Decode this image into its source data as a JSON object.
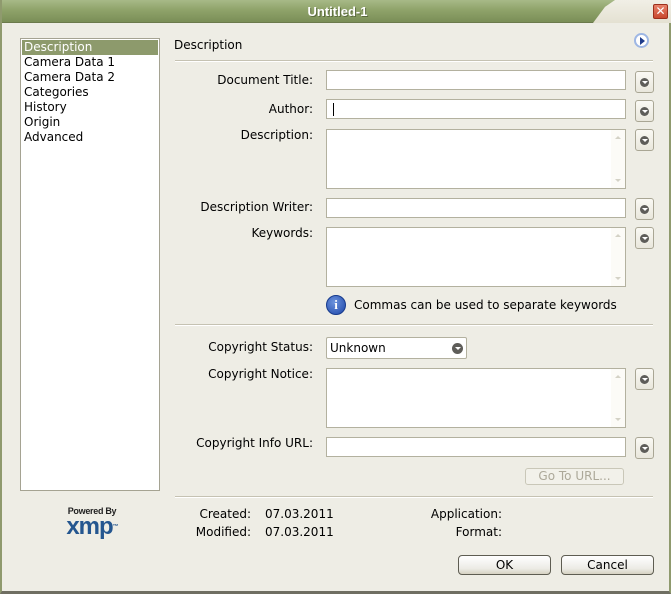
{
  "window": {
    "title": "Untitled-1",
    "close_icon": "close-icon"
  },
  "sidebar": {
    "items": [
      {
        "label": "Description",
        "selected": true
      },
      {
        "label": "Camera Data 1",
        "selected": false
      },
      {
        "label": "Camera Data 2",
        "selected": false
      },
      {
        "label": "Categories",
        "selected": false
      },
      {
        "label": "History",
        "selected": false
      },
      {
        "label": "Origin",
        "selected": false
      },
      {
        "label": "Advanced",
        "selected": false
      }
    ]
  },
  "logo": {
    "powered_by": "Powered By",
    "brand": "xmp",
    "tm": "™"
  },
  "panel": {
    "title": "Description",
    "nav_icon": "play-arrow-icon"
  },
  "fields": {
    "document_title": {
      "label": "Document Title:",
      "value": ""
    },
    "author": {
      "label": "Author:",
      "value": ""
    },
    "description": {
      "label": "Description:",
      "value": ""
    },
    "description_writer": {
      "label": "Description Writer:",
      "value": ""
    },
    "keywords": {
      "label": "Keywords:",
      "value": ""
    },
    "keywords_hint": "Commas can be used to separate keywords",
    "copyright_status": {
      "label": "Copyright Status:",
      "value": "Unknown"
    },
    "copyright_notice": {
      "label": "Copyright Notice:",
      "value": ""
    },
    "copyright_url": {
      "label": "Copyright Info URL:",
      "value": ""
    },
    "goto_url_label": "Go To URL..."
  },
  "meta": {
    "created_label": "Created:",
    "created_value": "07.03.2011",
    "modified_label": "Modified:",
    "modified_value": "07.03.2011",
    "application_label": "Application:",
    "application_value": "",
    "format_label": "Format:",
    "format_value": ""
  },
  "buttons": {
    "ok": "OK",
    "cancel": "Cancel"
  },
  "colors": {
    "titlebar": "#8FA36A",
    "selection": "#8D9A6C",
    "xmp_blue": "#24568F",
    "info_blue": "#1C45A8"
  }
}
